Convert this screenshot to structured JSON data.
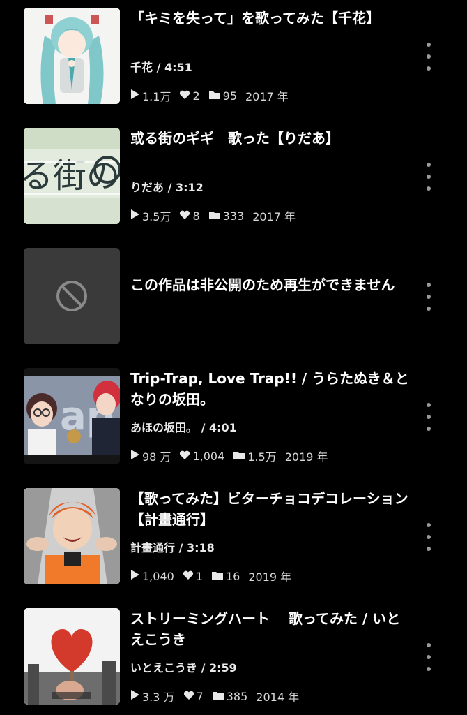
{
  "items": [
    {
      "title": "「キミを失って」を歌ってみた【千花】",
      "meta": "千花 / 4:51",
      "views": "1.1万",
      "likes": "2",
      "mylists": "95",
      "year": "2017 年"
    },
    {
      "title": "或る街のギギ　歌った【りだあ】",
      "meta": "りだあ / 3:12",
      "views": "3.5万",
      "likes": "8",
      "mylists": "333",
      "year": "2017 年"
    },
    {
      "title": "この作品は非公開のため再生ができません"
    },
    {
      "title": "Trip-Trap, Love Trap!! / うらたぬき＆となりの坂田。",
      "meta": "あほの坂田。 / 4:01",
      "views": "98 万",
      "likes": "1,004",
      "mylists": "1.5万",
      "year": "2019 年"
    },
    {
      "title": "【歌ってみた】ビターチョコデコレーション【計畫通行】",
      "meta": "計畫通行 / 3:18",
      "views": "1,040",
      "likes": "1",
      "mylists": "16",
      "year": "2019 年"
    },
    {
      "title": "ストリーミングハート　 歌ってみた / いとえこうき",
      "meta": "いとえこうき / 2:59",
      "views": "3.3 万",
      "likes": "7",
      "mylists": "385",
      "year": "2014 年"
    }
  ],
  "icons": {
    "views": "play-icon",
    "likes": "heart-icon",
    "mylists": "folder-icon",
    "more": "more-vertical-icon",
    "private": "prohibited-icon"
  },
  "colors": {
    "background": "#000000",
    "text": "#ffffff",
    "stats": "#d8d8d8",
    "more_dots": "#9a9a9a",
    "placeholder": "#3a3a3a"
  }
}
